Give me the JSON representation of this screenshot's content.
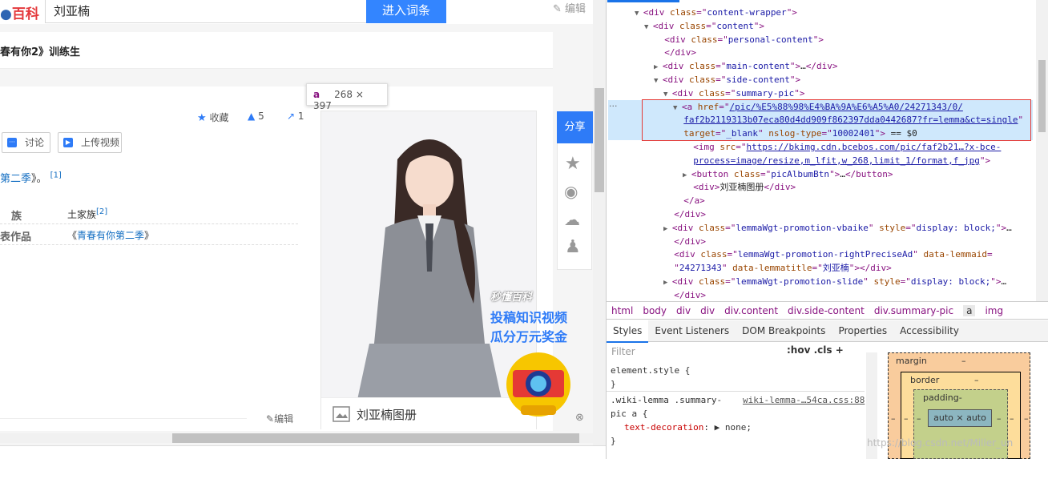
{
  "header": {
    "logo_text": "百科",
    "search_value": "刘亚楠",
    "enter_button": "进入词条",
    "edit_label": "编辑"
  },
  "lemma_title": "春有你2》训练生",
  "tools": {
    "collect": "收藏",
    "like_count": "5",
    "share_count": "1",
    "discuss": "讨论",
    "upload_video": "上传视频"
  },
  "summary": {
    "text_link": "第二季",
    "text_tail": "》。",
    "ref1": "[1]"
  },
  "info_rows": [
    {
      "label": "族",
      "value": "土家族",
      "ref": "[2]"
    },
    {
      "label": "表作品",
      "value_prefix": "《",
      "value_link": "青春有你第二季",
      "value_suffix": "》"
    }
  ],
  "edit_bottom": "编辑",
  "tooltip": {
    "tag": "a",
    "dims": "268 × 397"
  },
  "album_label": "刘亚楠图册",
  "share_panel": {
    "share_label": "分享"
  },
  "promo": {
    "brand": "秒懂百科",
    "line1": "投稿知识视频",
    "line2": "瓜分万元奖金"
  },
  "dom_lines": [
    {
      "indent": 3,
      "arrow": "▼",
      "parts": [
        [
          "tg",
          "<div "
        ],
        [
          "an",
          "class"
        ],
        [
          "tg",
          "=\""
        ],
        [
          "av",
          "content-wrapper"
        ],
        [
          "tg",
          "\">"
        ]
      ]
    },
    {
      "indent": 4,
      "arrow": "▼",
      "parts": [
        [
          "tg",
          "<div "
        ],
        [
          "an",
          "class"
        ],
        [
          "tg",
          "=\""
        ],
        [
          "av",
          "content"
        ],
        [
          "tg",
          "\">"
        ]
      ]
    },
    {
      "indent": 5,
      "arrow": "",
      "parts": [
        [
          "tg",
          "<div "
        ],
        [
          "an",
          "class"
        ],
        [
          "tg",
          "=\""
        ],
        [
          "av",
          "personal-content"
        ],
        [
          "tg",
          "\">"
        ]
      ]
    },
    {
      "indent": 5,
      "arrow": "",
      "parts": [
        [
          "tg",
          "</div>"
        ]
      ]
    },
    {
      "indent": 5,
      "arrow": "▶",
      "parts": [
        [
          "tg",
          "<div "
        ],
        [
          "an",
          "class"
        ],
        [
          "tg",
          "=\""
        ],
        [
          "av",
          "main-content"
        ],
        [
          "tg",
          "\">"
        ],
        [
          "tx",
          "…"
        ],
        [
          "tg",
          "</div>"
        ]
      ]
    },
    {
      "indent": 5,
      "arrow": "▼",
      "parts": [
        [
          "tg",
          "<div "
        ],
        [
          "an",
          "class"
        ],
        [
          "tg",
          "=\""
        ],
        [
          "av",
          "side-content"
        ],
        [
          "tg",
          "\">"
        ]
      ]
    },
    {
      "indent": 6,
      "arrow": "▼",
      "parts": [
        [
          "tg",
          "<div "
        ],
        [
          "an",
          "class"
        ],
        [
          "tg",
          "=\""
        ],
        [
          "av",
          "summary-pic"
        ],
        [
          "tg",
          "\">"
        ]
      ]
    },
    {
      "indent": 7,
      "arrow": "▼",
      "parts": [
        [
          "tg",
          "<a "
        ],
        [
          "an",
          "href"
        ],
        [
          "tg",
          "=\""
        ],
        [
          "av",
          "/pic/%E5%88%98%E4%BA%9A%E6%A5%A0/24271343/0/"
        ]
      ]
    },
    {
      "indent": 7,
      "arrow": "",
      "parts": [
        [
          "av",
          "faf2b2119313b07eca80d4dd909f862397dda0442687?fr=lemma&ct=single"
        ],
        [
          "tg",
          "\""
        ]
      ]
    },
    {
      "indent": 7,
      "arrow": "",
      "parts": [
        [
          "an",
          "target"
        ],
        [
          "tg",
          "=\""
        ],
        [
          "av",
          "_blank"
        ],
        [
          "tg",
          "\" "
        ],
        [
          "an",
          "nslog-type"
        ],
        [
          "tg",
          "=\""
        ],
        [
          "av",
          "10002401"
        ],
        [
          "tg",
          "\">"
        ],
        [
          "tx",
          " == $0"
        ]
      ]
    },
    {
      "indent": 8,
      "arrow": "",
      "parts": [
        [
          "tg",
          "<img "
        ],
        [
          "an",
          "src"
        ],
        [
          "tg",
          "=\""
        ],
        [
          "av",
          "https://bkimg.cdn.bcebos.com/pic/faf2b21…?x-bce-"
        ]
      ]
    },
    {
      "indent": 8,
      "arrow": "",
      "parts": [
        [
          "av",
          "process=image/resize,m_lfit,w_268,limit_1/format,f_jpg"
        ],
        [
          "tg",
          "\">"
        ]
      ]
    },
    {
      "indent": 8,
      "arrow": "▶",
      "parts": [
        [
          "tg",
          "<button "
        ],
        [
          "an",
          "class"
        ],
        [
          "tg",
          "=\""
        ],
        [
          "av",
          "picAlbumBtn"
        ],
        [
          "tg",
          "\">"
        ],
        [
          "tx",
          "…"
        ],
        [
          "tg",
          "</button>"
        ]
      ]
    },
    {
      "indent": 8,
      "arrow": "",
      "parts": [
        [
          "tg",
          "<div>"
        ],
        [
          "tx",
          "刘亚楠图册"
        ],
        [
          "tg",
          "</div>"
        ]
      ]
    },
    {
      "indent": 7,
      "arrow": "",
      "parts": [
        [
          "tg",
          "</a>"
        ]
      ]
    },
    {
      "indent": 6,
      "arrow": "",
      "parts": [
        [
          "tg",
          "</div>"
        ]
      ]
    },
    {
      "indent": 6,
      "arrow": "▶",
      "parts": [
        [
          "tg",
          "<div "
        ],
        [
          "an",
          "class"
        ],
        [
          "tg",
          "=\""
        ],
        [
          "av",
          "lemmaWgt-promotion-vbaike"
        ],
        [
          "tg",
          "\" "
        ],
        [
          "an",
          "style"
        ],
        [
          "tg",
          "=\""
        ],
        [
          "av",
          "display: block;"
        ],
        [
          "tg",
          "\">"
        ],
        [
          "tx",
          "…"
        ]
      ]
    },
    {
      "indent": 6,
      "arrow": "",
      "parts": [
        [
          "tg",
          "</div>"
        ]
      ]
    },
    {
      "indent": 6,
      "arrow": "",
      "parts": [
        [
          "tg",
          "<div "
        ],
        [
          "an",
          "class"
        ],
        [
          "tg",
          "=\""
        ],
        [
          "av",
          "lemmaWgt-promotion-rightPreciseAd"
        ],
        [
          "tg",
          "\" "
        ],
        [
          "an",
          "data-lemmaid"
        ],
        [
          "tg",
          "="
        ]
      ]
    },
    {
      "indent": 6,
      "arrow": "",
      "parts": [
        [
          "tg",
          "\""
        ],
        [
          "av",
          "24271343"
        ],
        [
          "tg",
          "\" "
        ],
        [
          "an",
          "data-lemmatitle"
        ],
        [
          "tg",
          "=\""
        ],
        [
          "av",
          "刘亚楠"
        ],
        [
          "tg",
          "\">"
        ],
        [
          "tg",
          "</div>"
        ]
      ]
    },
    {
      "indent": 6,
      "arrow": "▶",
      "parts": [
        [
          "tg",
          "<div "
        ],
        [
          "an",
          "class"
        ],
        [
          "tg",
          "=\""
        ],
        [
          "av",
          "lemmaWgt-promotion-slide"
        ],
        [
          "tg",
          "\" "
        ],
        [
          "an",
          "style"
        ],
        [
          "tg",
          "=\""
        ],
        [
          "av",
          "display: block;"
        ],
        [
          "tg",
          "\">"
        ],
        [
          "tx",
          "…"
        ]
      ]
    },
    {
      "indent": 6,
      "arrow": "",
      "parts": [
        [
          "tg",
          "</div>"
        ]
      ]
    }
  ],
  "breadcrumbs": [
    "html",
    "body",
    "div",
    "div",
    "div.content",
    "div.side-content",
    "div.summary-pic",
    "a",
    "img"
  ],
  "tabs": [
    "Styles",
    "Event Listeners",
    "DOM Breakpoints",
    "Properties",
    "Accessibility"
  ],
  "filter_placeholder": "Filter",
  "hov_cls": ":hov  .cls",
  "styles": {
    "element_style": "element.style {",
    "close": "}",
    "rule_selector": ".wiki-lemma .summary-",
    "rule_selector2": "pic a {",
    "rule_source": "wiki-lemma-…54ca.css:88",
    "prop": "text-decoration",
    "val": "none;"
  },
  "box_model": {
    "margin": "margin",
    "border": "border",
    "padding": "padding-",
    "content": "auto × auto",
    "dash": "–"
  },
  "watermark": "https://blog.csdn.net/Miller_un"
}
